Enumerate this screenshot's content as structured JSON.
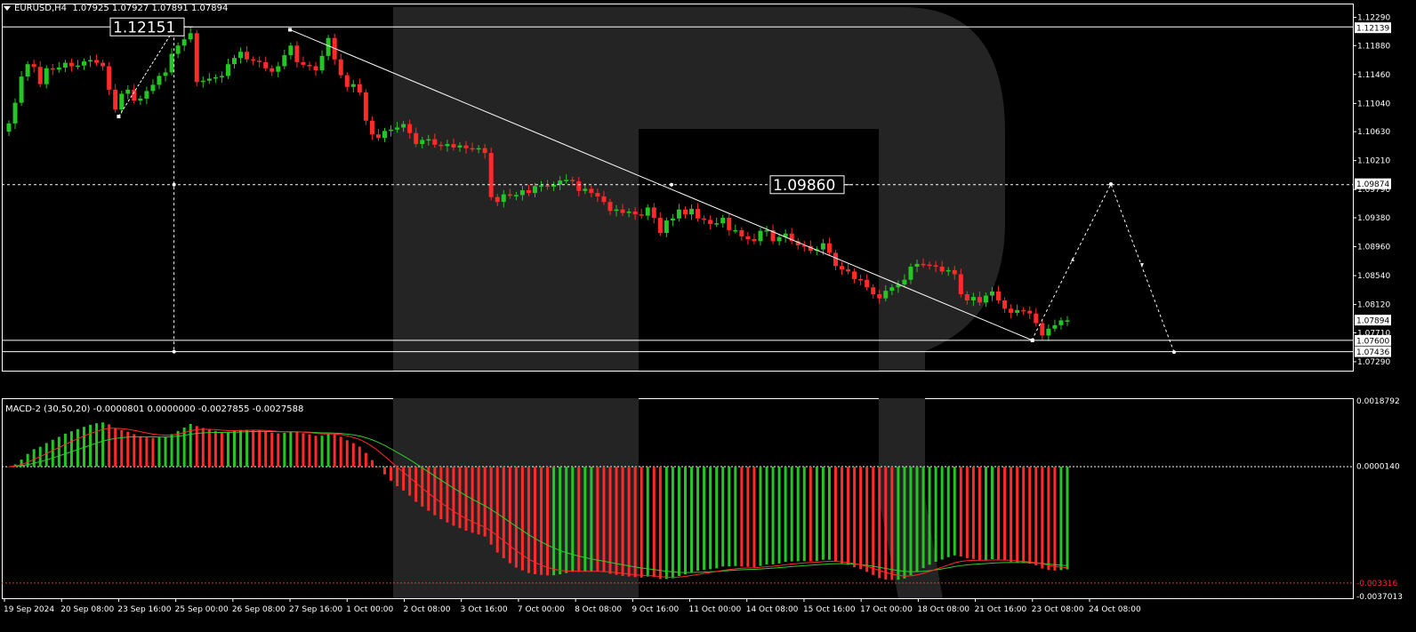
{
  "header": {
    "symbol": "EURUSD,H4",
    "ohlc": "1.07925 1.07927 1.07891 1.07894"
  },
  "macd": {
    "label": "MACD-2 (30,50,20) -0.0000801 0.0000000 -0.0027855 -0.0027588"
  },
  "colors": {
    "background": "#000000",
    "bull": "#26c526",
    "bear": "#ff2a2a",
    "grid": "#ffffff",
    "signal_line": "#2ecc2e",
    "macd_line": "#ff2a2a",
    "watermark": "#242424"
  },
  "chart_data": [
    {
      "type": "candlestick",
      "title": "EURUSD,H4",
      "ylim": [
        1.0716,
        1.1249
      ],
      "y_ticks": [
        "1.12290",
        "1.11880",
        "1.11460",
        "1.11040",
        "1.10630",
        "1.10210",
        "1.09790",
        "1.09380",
        "1.08960",
        "1.08540",
        "1.08120",
        "1.07710",
        "1.07290"
      ],
      "x_ticks": [
        "19 Sep 2024",
        "20 Sep 08:00",
        "23 Sep 16:00",
        "25 Sep 00:00",
        "26 Sep 08:00",
        "27 Sep 16:00",
        "1 Oct 00:00",
        "2 Oct 08:00",
        "3 Oct 16:00",
        "7 Oct 00:00",
        "8 Oct 08:00",
        "9 Oct 16:00",
        "11 Oct 00:00",
        "14 Oct 08:00",
        "15 Oct 16:00",
        "17 Oct 00:00",
        "18 Oct 08:00",
        "21 Oct 16:00",
        "23 Oct 08:00",
        "24 Oct 08:00"
      ],
      "price_labels": [
        {
          "text": "1.12139",
          "value": 1.12139,
          "highlight": true
        },
        {
          "text": "1.09874",
          "value": 1.09874,
          "highlight": true
        },
        {
          "text": "1.07894",
          "value": 1.07894,
          "highlight": true
        },
        {
          "text": "1.07600",
          "value": 1.076,
          "highlight": true
        },
        {
          "text": "1.07436",
          "value": 1.07436,
          "highlight": true
        }
      ],
      "annotations": [
        {
          "text": "1.12151",
          "value": 1.12151
        },
        {
          "text": "1.09860",
          "value": 1.0986
        }
      ],
      "series_close": [
        1.1075,
        1.1105,
        1.1143,
        1.1161,
        1.1157,
        1.1132,
        1.1155,
        1.1153,
        1.1156,
        1.1163,
        1.1158,
        1.1159,
        1.1165,
        1.1167,
        1.1163,
        1.1158,
        1.1124,
        1.1095,
        1.1118,
        1.1124,
        1.1108,
        1.1111,
        1.1122,
        1.1131,
        1.1144,
        1.1149,
        1.1176,
        1.1188,
        1.1197,
        1.1206,
        1.1135,
        1.1137,
        1.114,
        1.1142,
        1.1144,
        1.1161,
        1.117,
        1.1179,
        1.1168,
        1.1166,
        1.1164,
        1.1155,
        1.115,
        1.1158,
        1.1174,
        1.1188,
        1.1164,
        1.116,
        1.1158,
        1.1152,
        1.1173,
        1.1199,
        1.1168,
        1.1145,
        1.1128,
        1.1132,
        1.112,
        1.1079,
        1.1059,
        1.1054,
        1.1064,
        1.1066,
        1.1069,
        1.1074,
        1.1061,
        1.1045,
        1.1051,
        1.1052,
        1.1044,
        1.1042,
        1.1045,
        1.104,
        1.1043,
        1.1039,
        1.1038,
        1.1039,
        1.1032,
        1.0968,
        1.0961,
        1.0972,
        1.097,
        1.0971,
        1.0978,
        1.0974,
        1.0984,
        1.0985,
        1.0983,
        1.0986,
        1.0992,
        1.0993,
        1.0991,
        1.0977,
        1.098,
        1.0974,
        1.0969,
        1.0961,
        1.0948,
        1.095,
        1.0945,
        1.0947,
        1.0943,
        1.0941,
        1.0953,
        1.0938,
        1.0916,
        1.0934,
        1.0937,
        1.095,
        1.0943,
        1.0951,
        1.0937,
        1.0935,
        1.0929,
        1.093,
        1.0938,
        1.092,
        1.092,
        1.0911,
        1.0907,
        1.0904,
        1.0919,
        1.092,
        1.0904,
        1.091,
        1.0915,
        1.0904,
        1.0898,
        1.0897,
        1.089,
        1.0892,
        1.0901,
        1.0887,
        1.0868,
        1.0863,
        1.086,
        1.0849,
        1.0848,
        1.0837,
        1.0827,
        1.0821,
        1.0832,
        1.0837,
        1.0841,
        1.0848,
        1.0867,
        1.0871,
        1.087,
        1.0869,
        1.0867,
        1.086,
        1.0862,
        1.0856,
        1.0827,
        1.0818,
        1.0823,
        1.0815,
        1.0825,
        1.0831,
        1.0818,
        1.0806,
        1.08,
        1.0804,
        1.0803,
        1.0799,
        1.0785,
        1.0767,
        1.0777,
        1.0782,
        1.0789,
        1.0789
      ],
      "trend_lines": [
        {
          "from": [
            "23 Sep 16:00",
            1.1085
          ],
          "to": [
            "25 Sep 00:00",
            1.1216
          ]
        },
        {
          "from": [
            "27 Sep 16:00",
            1.1211
          ],
          "to": [
            "23 Oct 08:00",
            1.076
          ]
        }
      ],
      "horizontal_lines": [
        1.12151,
        1.0986,
        1.076,
        1.07436
      ],
      "forecast_path": [
        1.076,
        1.0987,
        1.0743
      ]
    },
    {
      "type": "histogram",
      "title": "MACD-2 (30,50,20)",
      "ylim": [
        -0.00375,
        0.00195
      ],
      "y_ticks": [
        "0.0018792",
        "0.0000140",
        "-0.003316",
        "-0.0037013"
      ],
      "histogram_min": -0.00323,
      "histogram_max": 0.00126,
      "last_values": {
        "macd": -0.0027855,
        "signal": -0.0027588
      }
    }
  ]
}
